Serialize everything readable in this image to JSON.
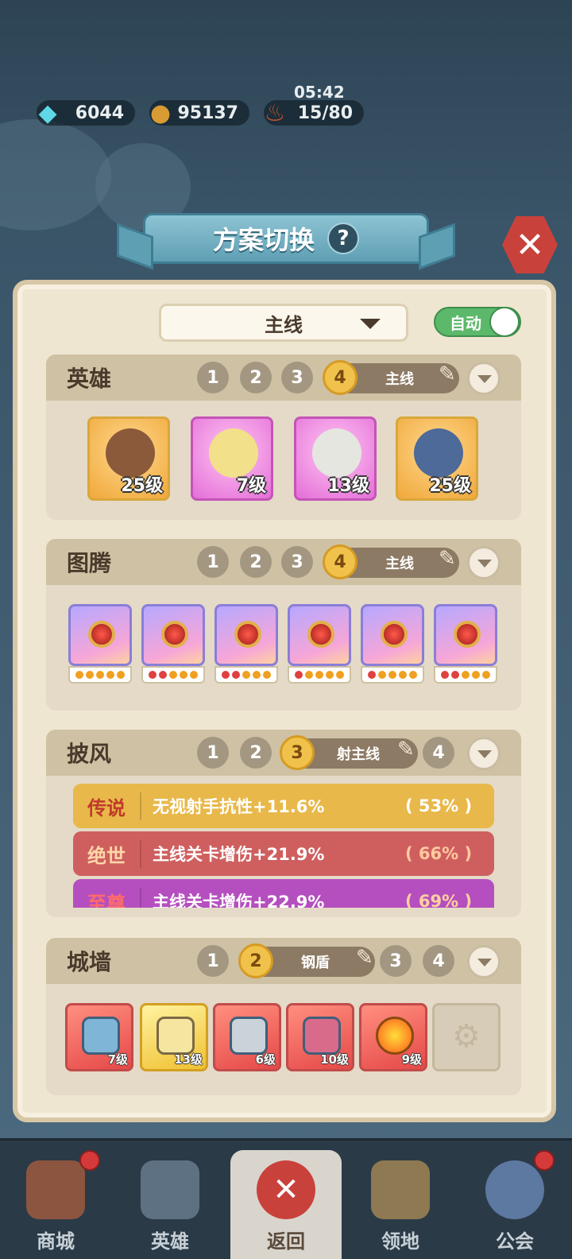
{
  "resources": {
    "gems": "6044",
    "coins": "95137",
    "stamina": "15/80",
    "timer": "05:42"
  },
  "dialog": {
    "title": "方案切换",
    "help": "?",
    "scheme": "主线",
    "auto_label": "自动"
  },
  "heroes": {
    "title": "英雄",
    "slots": [
      "1",
      "2",
      "3",
      "4"
    ],
    "active_name": "主线",
    "cards": [
      {
        "level": "25级",
        "color": "orange"
      },
      {
        "level": "7级",
        "color": "pink"
      },
      {
        "level": "13级",
        "color": "pink"
      },
      {
        "level": "25级",
        "color": "orange"
      }
    ]
  },
  "totems": {
    "title": "图腾",
    "slots": [
      "1",
      "2",
      "3",
      "4"
    ],
    "active_name": "主线"
  },
  "cloak": {
    "title": "披风",
    "slots": [
      "1",
      "2",
      "3",
      "4"
    ],
    "active_name": "射主线",
    "rows": [
      {
        "tier": "传说",
        "desc": "无视射手抗性+11.6%",
        "pct": "( 53% )",
        "bg": "#e8b84a",
        "tier_color": "#c0392b",
        "pct_color": "#fff"
      },
      {
        "tier": "绝世",
        "desc": "主线关卡增伤+21.9%",
        "pct": "( 66% )",
        "bg": "#cf5f5f",
        "tier_color": "#ffd6a8",
        "pct_color": "#ffc9a0"
      },
      {
        "tier": "至尊",
        "desc": "主线关卡增伤+22.9%",
        "pct": "( 69% )",
        "bg": "#b54fbf",
        "tier_color": "#ff6b6b",
        "pct_color": "#ffd0a0"
      }
    ]
  },
  "walls": {
    "title": "城墙",
    "slots": [
      "1",
      "2",
      "3",
      "4"
    ],
    "active_name": "钢盾",
    "items": [
      {
        "level": "7级",
        "color": "red"
      },
      {
        "level": "13级",
        "color": "yellow"
      },
      {
        "level": "6级",
        "color": "red"
      },
      {
        "level": "10级",
        "color": "red"
      },
      {
        "level": "9级",
        "color": "red"
      },
      {
        "level": "",
        "color": "locked"
      }
    ]
  },
  "nav": {
    "shop": "商城",
    "heroes": "英雄",
    "back": "返回",
    "territory": "领地",
    "guild": "公会"
  }
}
